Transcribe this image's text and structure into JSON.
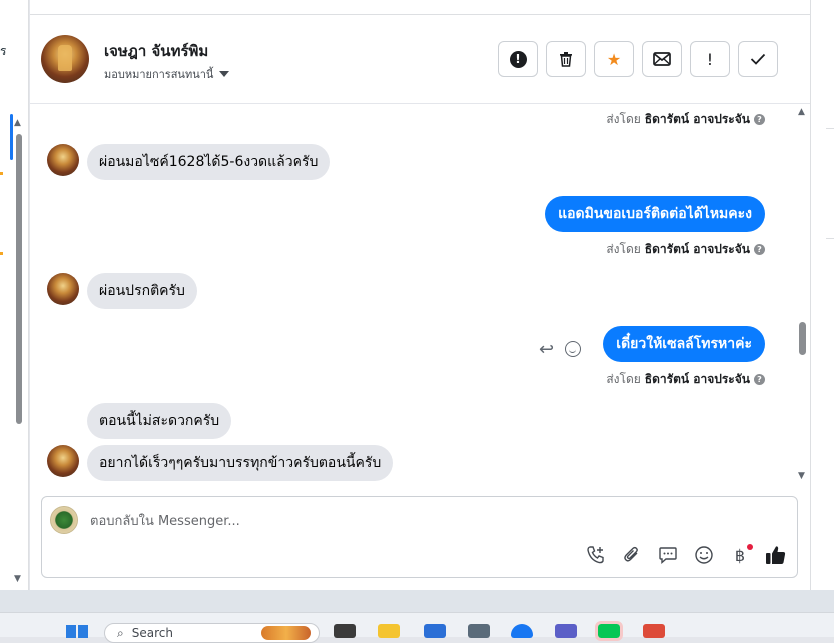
{
  "left_strip": {
    "cut_text": "ร"
  },
  "header": {
    "contact_name": "เจษฎา จันทร์พิม",
    "assign_label": "มอบหมายการสนทนานี้",
    "actions": [
      {
        "icon": "alert-circle-icon"
      },
      {
        "icon": "trash-icon"
      },
      {
        "icon": "star-icon"
      },
      {
        "icon": "envelope-icon"
      },
      {
        "icon": "exclamation-icon"
      },
      {
        "icon": "check-icon"
      }
    ]
  },
  "conversation": {
    "sent_by_prefix": "ส่งโดย",
    "sent_by_name": "ธิดารัตน์ อาจประจัน",
    "messages": [
      {
        "direction": "in",
        "text": "ผ่อนมอไซค์1628ได้5-6งวดแล้วครับ"
      },
      {
        "direction": "out",
        "text": "แอดมินขอเบอร์ติดต่อได้ไหมคะง"
      },
      {
        "direction": "in",
        "text": "ผ่อนปรกติครับ"
      },
      {
        "direction": "out",
        "text": "เดี๋ยวให้เซลล์โทรหาค่ะ"
      },
      {
        "direction": "in",
        "text": "ตอนนี้ไม่สะดวกครับ"
      },
      {
        "direction": "in",
        "text": "อยากได้เร็วๆๆครับมาบรรทุกข้าวครับตอนนี้ครับ"
      }
    ]
  },
  "composer": {
    "placeholder": "ตอบกลับใน Messenger...",
    "tools": [
      "phone-plus-icon",
      "paperclip-icon",
      "chat-bubble-icon",
      "smiley-icon",
      "baht-icon",
      "thumbs-up-icon"
    ],
    "baht_symbol": "฿"
  },
  "taskbar": {
    "search_label": "Search"
  }
}
